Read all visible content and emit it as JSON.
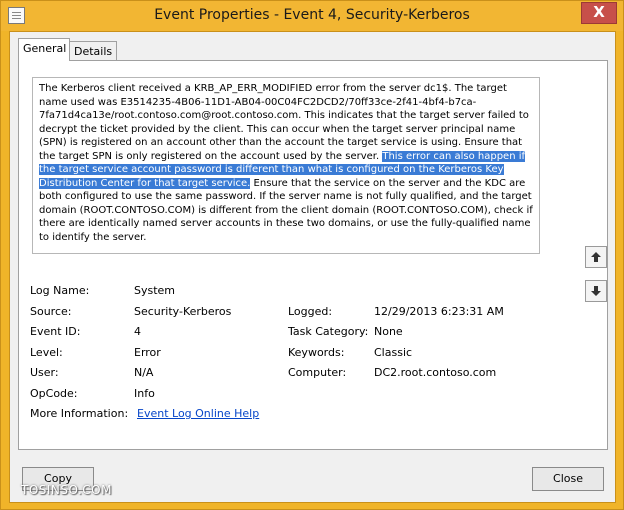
{
  "window": {
    "title": "Event Properties - Event 4, Security-Kerberos",
    "close_glyph": "X"
  },
  "tabs": [
    {
      "label": "General",
      "active": true
    },
    {
      "label": "Details",
      "active": false
    }
  ],
  "description": {
    "text_before": "The Kerberos client received a KRB_AP_ERR_MODIFIED error from the server dc1$. The target name used was E3514235-4B06-11D1-AB04-00C04FC2DCD2/70ff33ce-2f41-4bf4-b7ca-7fa71d4ca13e/root.contoso.com@root.contoso.com. This indicates that the target server failed to decrypt the ticket provided by the client. This can occur when the target server principal name (SPN) is registered on an account other than the account the target service is using. Ensure that the target SPN is only registered on the account used by the server. ",
    "text_highlighted": "This error can also happen if the target service account password is different than what is configured on the Kerberos Key Distribution Center for that target service.",
    "text_after": " Ensure that the service on the server and the KDC are both configured to use the same password. If the server name is not fully qualified, and the target domain (ROOT.CONTOSO.COM) is different from the client domain (ROOT.CONTOSO.COM), check if there are identically named server accounts in these two domains, or use the fully-qualified name to identify the server."
  },
  "fields": {
    "log_name": {
      "label": "Log Name:",
      "value": "System"
    },
    "source": {
      "label": "Source:",
      "value": "Security-Kerberos"
    },
    "logged": {
      "label": "Logged:",
      "value": "12/29/2013 6:23:31 AM"
    },
    "event_id": {
      "label": "Event ID:",
      "value": "4"
    },
    "task_category": {
      "label": "Task Category:",
      "value": "None"
    },
    "level": {
      "label": "Level:",
      "value": "Error"
    },
    "keywords": {
      "label": "Keywords:",
      "value": "Classic"
    },
    "user": {
      "label": "User:",
      "value": "N/A"
    },
    "computer": {
      "label": "Computer:",
      "value": "DC2.root.contoso.com"
    },
    "opcode": {
      "label": "OpCode:",
      "value": "Info"
    },
    "more_info": {
      "label": "More Information:",
      "link": "Event Log Online Help"
    }
  },
  "buttons": {
    "copy": "Copy",
    "close": "Close"
  },
  "watermark": "TOSINSO.COM",
  "icons": {
    "up": "arrow-up-icon",
    "down": "arrow-down-icon"
  }
}
